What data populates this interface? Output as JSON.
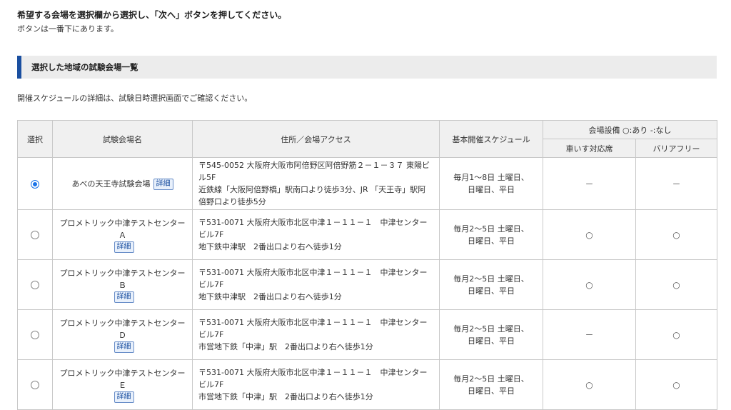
{
  "intro": {
    "line1": "希望する会場を選択欄から選択し、「次へ」ボタンを押してください。",
    "line2": "ボタンは一番下にあります。"
  },
  "section": {
    "title": "選択した地域の試験会場一覧"
  },
  "note": "開催スケジュールの詳細は、試験日時選択画面でご確認ください。",
  "table": {
    "headers": {
      "select": "選択",
      "name": "試験会場名",
      "address": "住所／会場アクセス",
      "schedule": "基本開催スケジュール",
      "facilities": "会場設備 ○:あり -:なし",
      "wheelchair": "車いす対応席",
      "barrierfree": "バリアフリー"
    },
    "detail_label": "詳細",
    "rows": [
      {
        "selected": true,
        "name": "あべの天王寺試験会場",
        "addr1": "〒545-0052 大阪府大阪市阿倍野区阿倍野筋２－１－３７ 東陽ビル5F",
        "addr2": "近鉄線「大阪阿倍野橋」駅南口より徒歩3分、JR 「天王寺」駅阿倍野口より徒歩5分",
        "sched1": "毎月1～8日 土曜日、",
        "sched2": "日曜日、平日",
        "wheelchair": "－",
        "barrierfree": "－"
      },
      {
        "selected": false,
        "name": "プロメトリック中津テストセンター Ａ",
        "addr1": "〒531-0071 大阪府大阪市北区中津１－１１－１　中津センタービル7F",
        "addr2": "地下鉄中津駅　2番出口より右へ徒歩1分",
        "sched1": "毎月2～5日 土曜日、",
        "sched2": "日曜日、平日",
        "wheelchair": "○",
        "barrierfree": "○"
      },
      {
        "selected": false,
        "name": "プロメトリック中津テストセンター Ｂ",
        "addr1": "〒531-0071 大阪府大阪市北区中津１－１１－１　中津センタービル7F",
        "addr2": "地下鉄中津駅　2番出口より右へ徒歩1分",
        "sched1": "毎月2～5日 土曜日、",
        "sched2": "日曜日、平日",
        "wheelchair": "○",
        "barrierfree": "○"
      },
      {
        "selected": false,
        "name": "プロメトリック中津テストセンター Ｄ",
        "addr1": "〒531-0071 大阪府大阪市北区中津１－１１－１　中津センタービル7F",
        "addr2": "市営地下鉄「中津」駅　2番出口より右へ徒歩1分",
        "sched1": "毎月2～5日 土曜日、",
        "sched2": "日曜日、平日",
        "wheelchair": "－",
        "barrierfree": "○"
      },
      {
        "selected": false,
        "name": "プロメトリック中津テストセンター Ｅ",
        "addr1": "〒531-0071 大阪府大阪市北区中津１－１１－１　中津センタービル7F",
        "addr2": "市営地下鉄「中津」駅　2番出口より右へ徒歩1分",
        "sched1": "毎月2～5日 土曜日、",
        "sched2": "日曜日、平日",
        "wheelchair": "○",
        "barrierfree": "○"
      }
    ]
  },
  "colors": {
    "accent": "#1a4fa0",
    "radio_selected": "#1a73e8",
    "header_bg": "#f0f0f0"
  }
}
